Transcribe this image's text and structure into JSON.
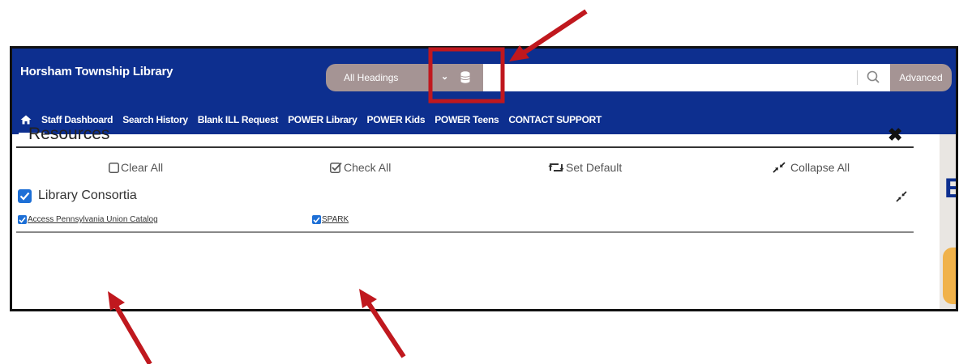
{
  "header": {
    "library_name": "Horsham Township Library",
    "search": {
      "scope_label": "All Headings",
      "input_value": "",
      "advanced_label": "Advanced"
    }
  },
  "nav": {
    "items": [
      {
        "label": "Staff Dashboard"
      },
      {
        "label": "Search History"
      },
      {
        "label": "Blank ILL Request"
      },
      {
        "label": "POWER Library"
      },
      {
        "label": "POWER Kids"
      },
      {
        "label": "POWER Teens"
      },
      {
        "label": "CONTACT SUPPORT"
      }
    ]
  },
  "resources": {
    "title": "Resources",
    "actions": {
      "clear_all": "Clear All",
      "check_all": "Check All",
      "set_default": "Set Default",
      "collapse_all": "Collapse All"
    },
    "group": {
      "label": "Library Consortia",
      "checked": true,
      "items": [
        {
          "label": "Access Pennsylvania Union Catalog",
          "checked": true
        },
        {
          "label": "SPARK",
          "checked": true
        }
      ]
    }
  },
  "background": {
    "letter": "E"
  },
  "colors": {
    "header_blue": "#0d2f8f",
    "search_segment": "#a59494",
    "checkbox_blue": "#1d6fd6",
    "annotation_red": "#c0181e"
  }
}
